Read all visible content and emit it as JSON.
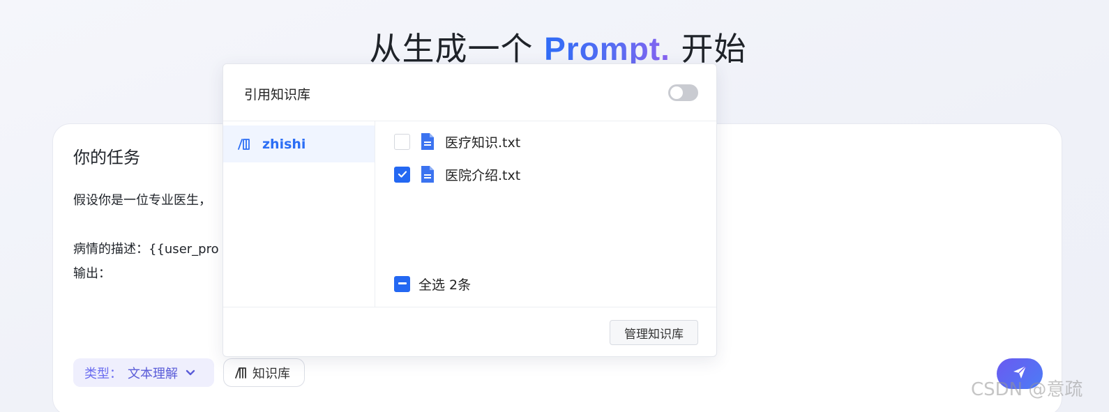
{
  "headline": {
    "prefix": "从生成一个",
    "accent": "Prompt.",
    "suffix": "开始"
  },
  "task_card": {
    "title": "你的任务",
    "text": "假设你是一位专业医生，\n\n病情的描述：{{user_pro\n输出：",
    "type_label": "类型：",
    "type_value": "文本理解",
    "kb_chip_label": "知识库"
  },
  "popup": {
    "title": "引用知识库",
    "toggle_on": false,
    "libraries": [
      {
        "name": "zhishi",
        "selected": true
      }
    ],
    "files": [
      {
        "name": "医疗知识.txt",
        "checked": false
      },
      {
        "name": "医院介绍.txt",
        "checked": true
      }
    ],
    "select_all_label": "全选 2条",
    "manage_button": "管理知识库"
  },
  "watermark": "CSDN @意疏",
  "colors": {
    "accent": "#2468f2",
    "purple": "#6a6cf0",
    "toggle_off": "#c9cbd1"
  }
}
